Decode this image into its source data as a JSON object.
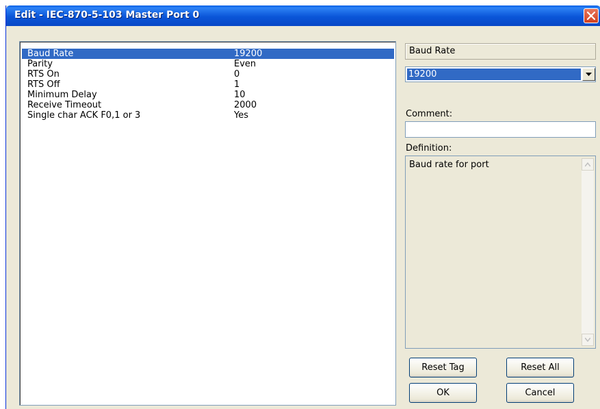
{
  "window": {
    "title": "Edit - IEC-870-5-103 Master Port 0"
  },
  "parameters": [
    {
      "name": "Baud Rate",
      "value": "19200",
      "selected": true
    },
    {
      "name": "Parity",
      "value": "Even"
    },
    {
      "name": "RTS On",
      "value": "0"
    },
    {
      "name": "RTS Off",
      "value": "1"
    },
    {
      "name": "Minimum Delay",
      "value": "10"
    },
    {
      "name": "Receive Timeout",
      "value": "2000"
    },
    {
      "name": "Single char ACK F0,1 or 3",
      "value": "Yes"
    }
  ],
  "editor": {
    "field_name": "Baud Rate",
    "selected_value": "19200",
    "comment_label": "Comment:",
    "comment_value": "",
    "definition_label": "Definition:",
    "definition_text": "Baud rate for port"
  },
  "buttons": {
    "reset_tag": "Reset Tag",
    "reset_all": "Reset All",
    "ok": "OK",
    "cancel": "Cancel"
  },
  "colors": {
    "selection": "#316ac5",
    "titlebar": "#0a55d8",
    "dialog_bg": "#ece9d8",
    "close_button": "#d2411f"
  },
  "icons": {
    "close": "close-icon",
    "dropdown": "chevron-down-icon",
    "scroll_up": "arrow-up-icon",
    "scroll_down": "arrow-down-icon"
  }
}
